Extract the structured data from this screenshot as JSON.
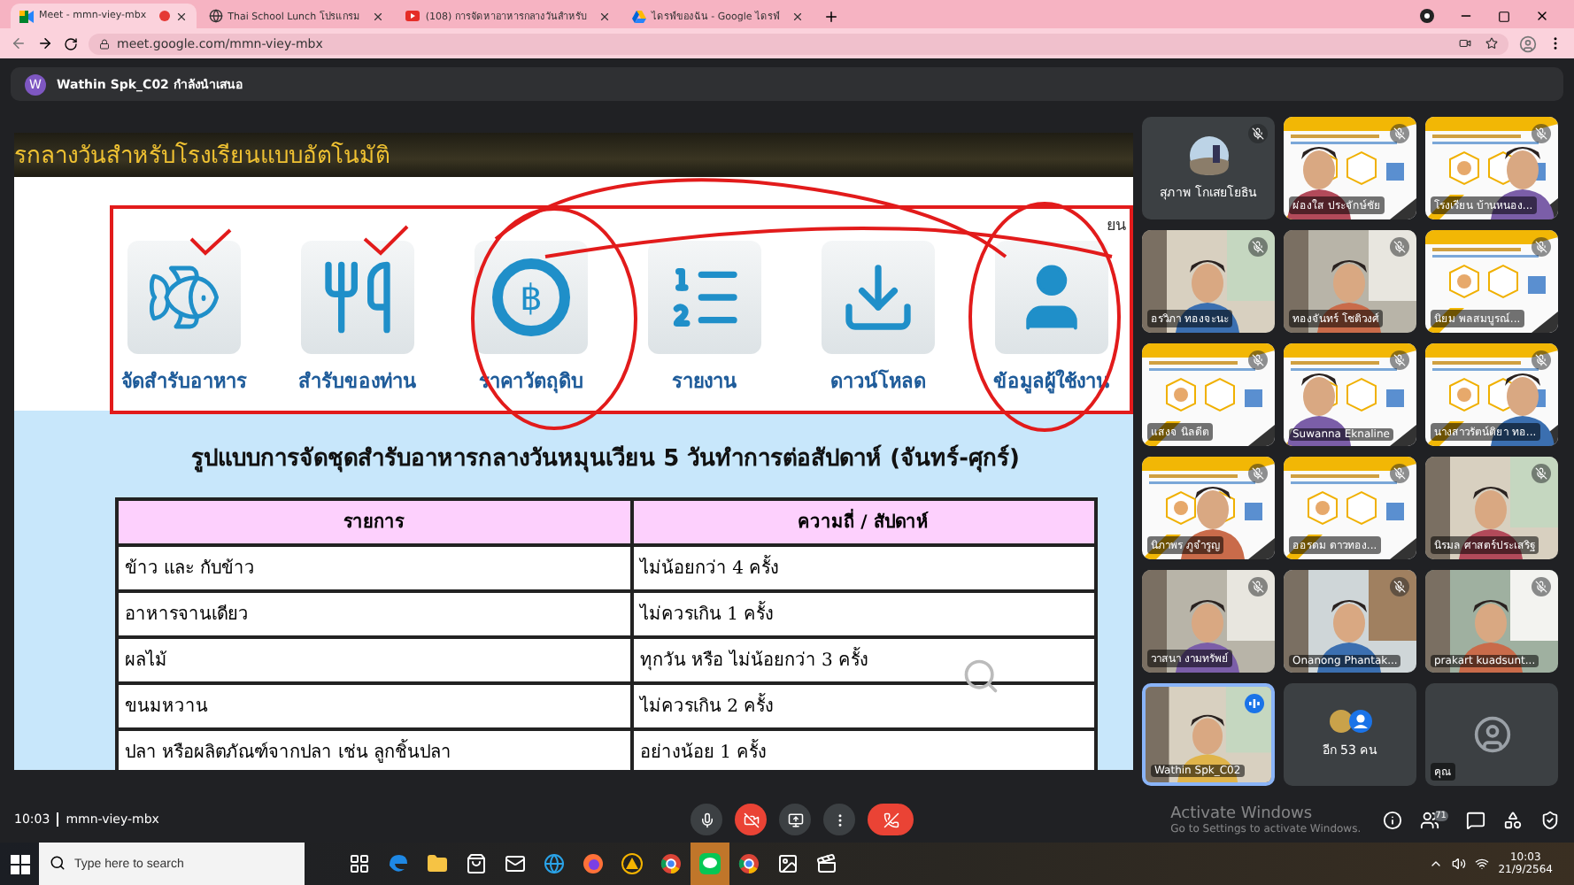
{
  "browser": {
    "tabs": [
      {
        "title": "Meet - mmn-viey-mbx",
        "selected": true,
        "kind": "meet",
        "recording": true
      },
      {
        "title": "Thai School Lunch โปรแกรม",
        "selected": false,
        "kind": "globe",
        "recording": false
      },
      {
        "title": "(108) การจัดหาอาหารกลางวันสำหรับ",
        "selected": false,
        "kind": "youtube",
        "recording": false
      },
      {
        "title": "ไดรฟ์ของฉัน - Google ไดรฟ์",
        "selected": false,
        "kind": "drive",
        "recording": false
      }
    ],
    "url": "meet.google.com/mmn-viey-mbx"
  },
  "presenter": {
    "initial": "W",
    "label": "Wathin Spk_C02 กำลังนำเสนอ"
  },
  "shared_screen": {
    "banner": "รกลางวันสำหรับโรงเรียนแบบอัตโนมัติ",
    "corner_text": "ยน",
    "menu": [
      {
        "label": "จัดสำรับอาหาร",
        "kind": "fish"
      },
      {
        "label": "สำรับของท่าน",
        "kind": "utensils"
      },
      {
        "label": "ราคาวัตถุดิบ",
        "kind": "baht",
        "glyph": "฿"
      },
      {
        "label": "รายงาน",
        "kind": "report"
      },
      {
        "label": "ดาวน์โหลด",
        "kind": "download"
      },
      {
        "label": "ข้อมูลผู้ใช้งาน",
        "kind": "user"
      }
    ],
    "title": "รูปแบบการจัดชุดสำรับอาหารกลางวันหมุนเวียน 5 วันทำการต่อสัปดาห์ (จันทร์-ศุกร์)",
    "table": {
      "columns": [
        "รายการ",
        "ความถี่ / สัปดาห์"
      ],
      "rows": [
        [
          "ข้าว และ กับข้าว",
          "ไม่น้อยกว่า 4 ครั้ง"
        ],
        [
          "อาหารจานเดียว",
          "ไม่ควรเกิน 1 ครั้ง"
        ],
        [
          "ผลไม้",
          "ทุกวัน หรือ ไม่น้อยกว่า 3 ครั้ง"
        ],
        [
          "ขนมหวาน",
          "ไม่ควรเกิน 2 ครั้ง"
        ],
        [
          "ปลา หรือผลิตภัณฑ์จากปลา เช่น ลูกชิ้นปลา",
          "อย่างน้อย 1 ครั้ง"
        ]
      ]
    }
  },
  "participants": [
    {
      "name": "สุภาพ โกเสยโยธิน",
      "kind": "avatar",
      "muted": true,
      "speaking": false
    },
    {
      "name": "ผ่องใส ประจักษ์ชัย",
      "kind": "slide_person",
      "muted": true,
      "speaking": false
    },
    {
      "name": "โรงเรียน บ้านหนอง...",
      "kind": "slide_person",
      "muted": true,
      "speaking": false
    },
    {
      "name": "อรวิภา ทองจะนะ",
      "kind": "person",
      "muted": true,
      "speaking": false
    },
    {
      "name": "ทองจันทร์ โชติวงศ์",
      "kind": "person",
      "muted": true,
      "speaking": false
    },
    {
      "name": "นิยม พลสมบูรณ์...",
      "kind": "slide",
      "muted": true,
      "speaking": false
    },
    {
      "name": "แสงจ นิลดีต",
      "kind": "slide",
      "muted": true,
      "speaking": false
    },
    {
      "name": "Suwanna Eknaline",
      "kind": "slide_person",
      "muted": true,
      "speaking": false
    },
    {
      "name": "นางสาวรัตน์ติยา ทอ...",
      "kind": "slide_person",
      "muted": true,
      "speaking": false
    },
    {
      "name": "นิภาพร ภูจำรูญ",
      "kind": "slide_person",
      "muted": true,
      "speaking": false
    },
    {
      "name": "ออรดม ดาวทอง...",
      "kind": "slide",
      "muted": true,
      "speaking": false
    },
    {
      "name": "นิรมล ศาสตร์ประเสริฐ",
      "kind": "person",
      "muted": true,
      "speaking": false
    },
    {
      "name": "วาสนา งามทรัพย์",
      "kind": "person",
      "muted": true,
      "speaking": false
    },
    {
      "name": "Onanong Phantak...",
      "kind": "person",
      "muted": true,
      "speaking": false
    },
    {
      "name": "prakart kuadsunt...",
      "kind": "person",
      "muted": true,
      "speaking": false
    },
    {
      "name": "Wathin Spk_C02",
      "kind": "person",
      "muted": false,
      "speaking": true
    },
    {
      "name": "อีก 53 คน",
      "kind": "more",
      "muted": false,
      "speaking": false
    },
    {
      "name": "คุณ",
      "kind": "self",
      "muted": false,
      "speaking": false
    }
  ],
  "meeting": {
    "time": "10:03",
    "code": "mmn-viey-mbx",
    "controls": [
      {
        "kind": "mic",
        "alert": false
      },
      {
        "kind": "camera_off",
        "alert": true
      },
      {
        "kind": "present",
        "alert": false
      },
      {
        "kind": "more",
        "alert": false
      },
      {
        "kind": "hangup",
        "alert": true
      }
    ],
    "side_icons": [
      {
        "kind": "info"
      },
      {
        "kind": "people",
        "badge": "71"
      },
      {
        "kind": "chat"
      },
      {
        "kind": "activities"
      },
      {
        "kind": "lock"
      }
    ]
  },
  "activation": {
    "title": "Activate Windows",
    "hint": "Go to Settings to activate Windows."
  },
  "taskbar": {
    "search_placeholder": "Type here to search",
    "apps": [
      {
        "kind": "taskview",
        "selected": false
      },
      {
        "kind": "edge",
        "selected": false
      },
      {
        "kind": "folder",
        "selected": false
      },
      {
        "kind": "store",
        "selected": false
      },
      {
        "kind": "mail",
        "selected": false
      },
      {
        "kind": "ie",
        "selected": false
      },
      {
        "kind": "firefox",
        "selected": false
      },
      {
        "kind": "app",
        "selected": false
      },
      {
        "kind": "chrome",
        "selected": false
      },
      {
        "kind": "line",
        "selected": true
      },
      {
        "kind": "chrome",
        "selected": false
      },
      {
        "kind": "photos",
        "selected": false
      },
      {
        "kind": "movies",
        "selected": false
      }
    ],
    "time": "10:03",
    "date": "21/9/2564"
  }
}
